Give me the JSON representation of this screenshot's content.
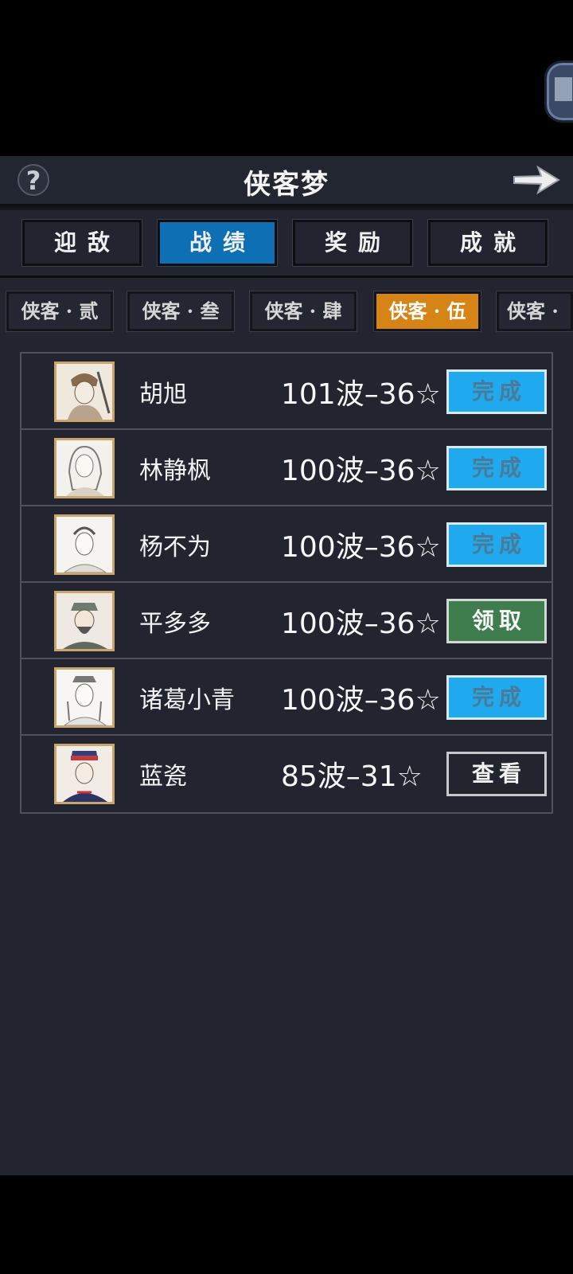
{
  "header": {
    "title": "侠客梦",
    "help_icon": "question-mark-icon",
    "back_icon": "arrow-right-icon"
  },
  "tabs": [
    {
      "label": "迎敌",
      "active": false
    },
    {
      "label": "战绩",
      "active": true
    },
    {
      "label": "奖励",
      "active": false
    },
    {
      "label": "成就",
      "active": false
    }
  ],
  "subtabs": [
    {
      "label": "侠客 · 贰",
      "active": false
    },
    {
      "label": "侠客 · 叁",
      "active": false
    },
    {
      "label": "侠客 · 肆",
      "active": false
    },
    {
      "label": "侠客 · 伍",
      "active": true
    },
    {
      "label": "侠客 ·",
      "active": false
    }
  ],
  "records": [
    {
      "name": "胡旭",
      "score": "101波–36☆",
      "action": "完成",
      "state": "done"
    },
    {
      "name": "林静枫",
      "score": "100波–36☆",
      "action": "完成",
      "state": "done"
    },
    {
      "name": "杨不为",
      "score": "100波–36☆",
      "action": "完成",
      "state": "done"
    },
    {
      "name": "平多多",
      "score": "100波–36☆",
      "action": "领取",
      "state": "claim"
    },
    {
      "name": "诸葛小青",
      "score": "100波–36☆",
      "action": "完成",
      "state": "done"
    },
    {
      "name": "蓝瓷",
      "score": "85波–31☆",
      "action": "查看",
      "state": "view"
    }
  ],
  "colors": {
    "active_tab": "#0f6fb4",
    "active_subtab": "#d78417",
    "done": "#1fa9ee",
    "claim": "#3f7d4f"
  }
}
